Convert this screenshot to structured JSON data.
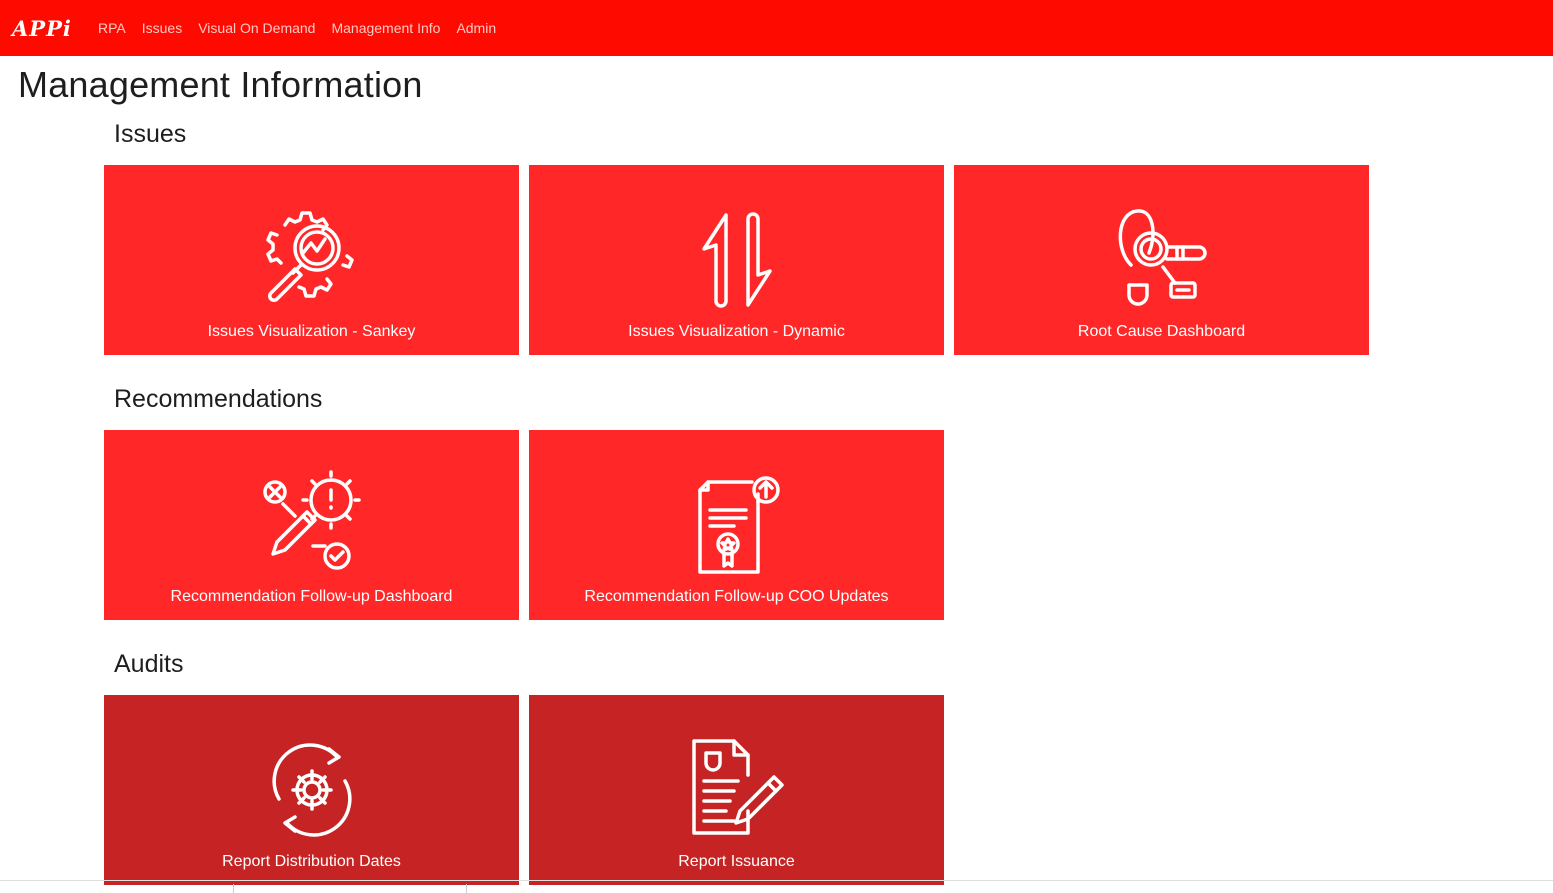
{
  "nav": {
    "brand": "APPi",
    "links": [
      "RPA",
      "Issues",
      "Visual On Demand",
      "Management Info",
      "Admin"
    ]
  },
  "page": {
    "title": "Management Information"
  },
  "sections": [
    {
      "title": "Issues",
      "tiles": [
        {
          "label": "Issues Visualization - Sankey",
          "icon": "gear-magnifier-icon"
        },
        {
          "label": "Issues Visualization - Dynamic",
          "icon": "up-down-arrows-icon"
        },
        {
          "label": "Root Cause Dashboard",
          "icon": "footprint-magnifier-icon"
        }
      ]
    },
    {
      "title": "Recommendations",
      "tiles": [
        {
          "label": "Recommendation Follow-up Dashboard",
          "icon": "pencil-gear-check-icon"
        },
        {
          "label": "Recommendation Follow-up COO Updates",
          "icon": "certificate-upload-icon"
        }
      ]
    },
    {
      "title": "Audits",
      "tiles": [
        {
          "label": "Report Distribution Dates",
          "icon": "gear-cycle-icon"
        },
        {
          "label": "Report Issuance",
          "icon": "document-pen-icon"
        }
      ]
    }
  ],
  "colors": {
    "navbar": "#ff0a00",
    "tile_bright": "#ff2727",
    "tile_dark": "#c62424",
    "nav_link": "#ffd9d6"
  }
}
